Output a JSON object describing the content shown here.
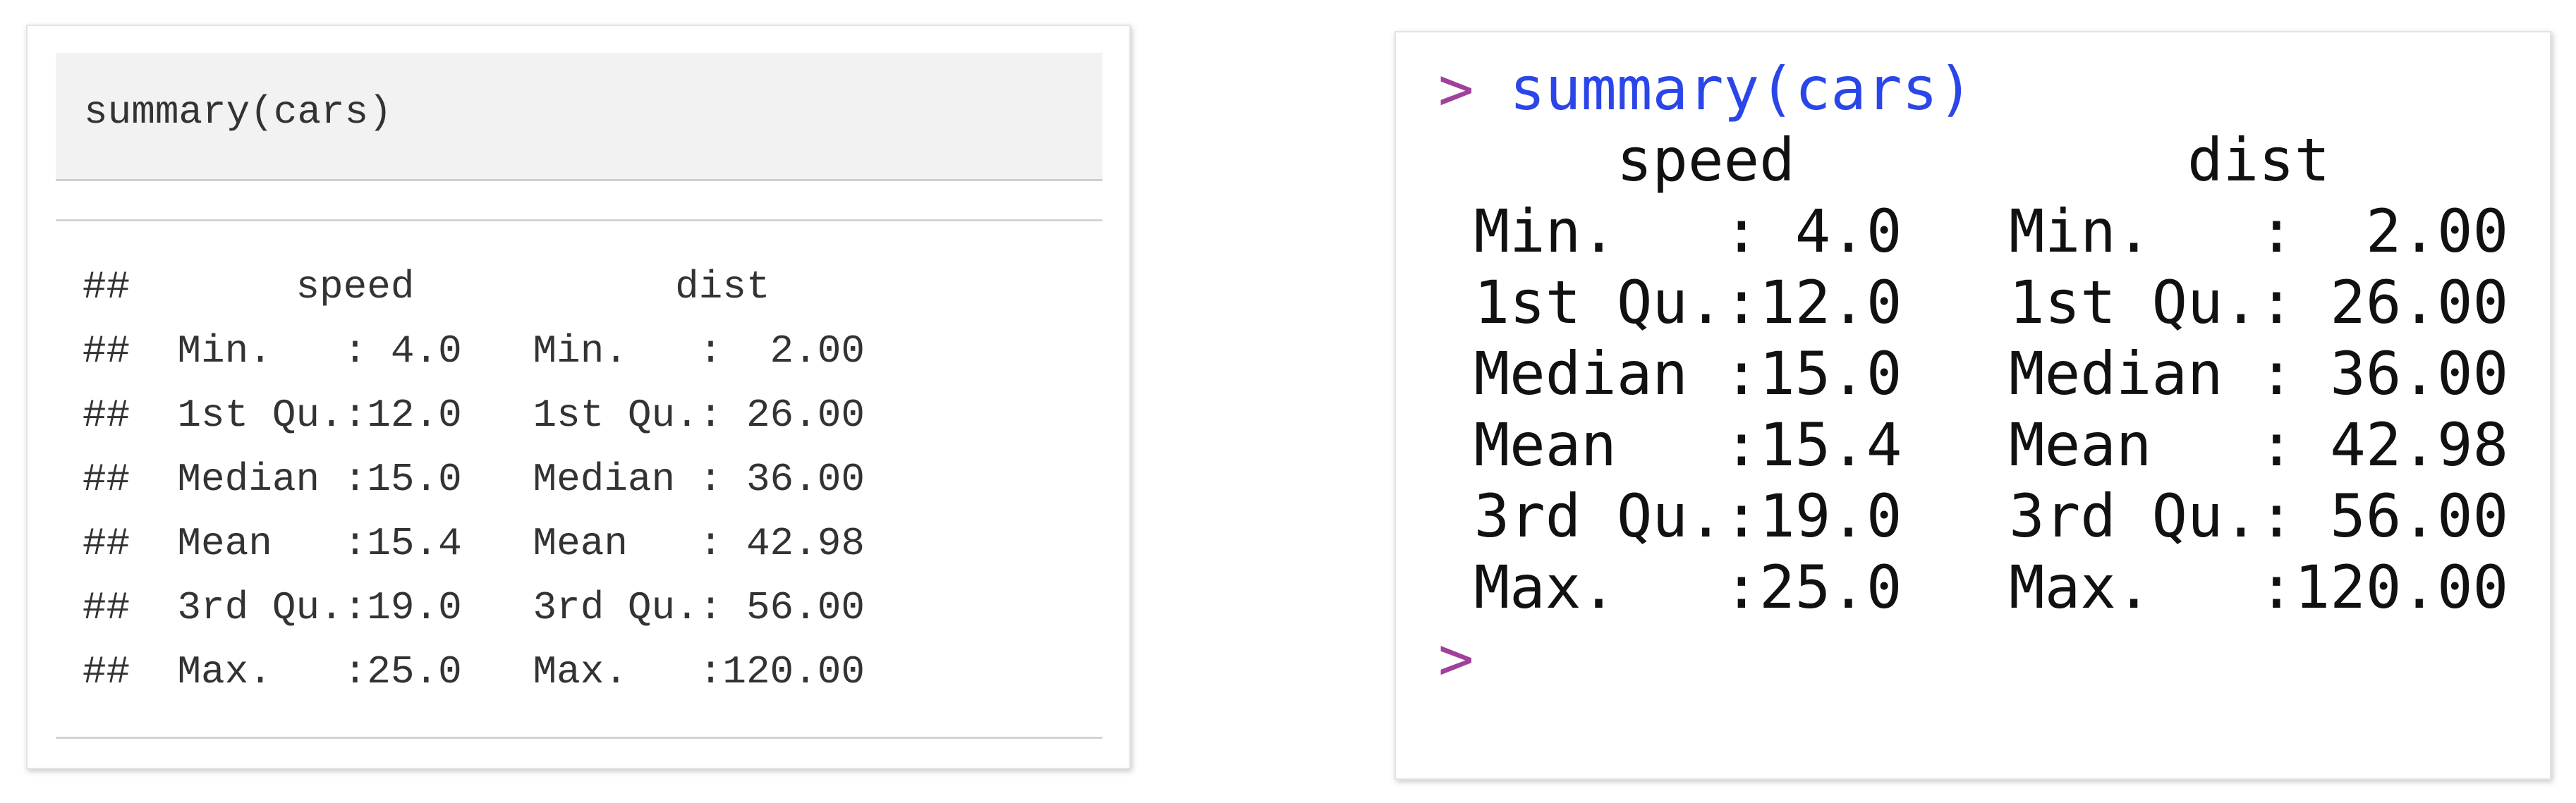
{
  "colors": {
    "prompt": "#a0409c",
    "command": "#2b46e8",
    "output_text": "#111111",
    "rmd_text": "#333333",
    "code_chunk_bg": "#f2f2f2"
  },
  "rmarkdown": {
    "code": "summary(cars)",
    "output_lines": [
      "##       speed           dist       ",
      "##  Min.   : 4.0   Min.   :  2.00  ",
      "##  1st Qu.:12.0   1st Qu.: 26.00  ",
      "##  Median :15.0   Median : 36.00  ",
      "##  Mean   :15.4   Mean   : 42.98  ",
      "##  3rd Qu.:19.0   3rd Qu.: 56.00  ",
      "##  Max.   :25.0   Max.   :120.00  "
    ]
  },
  "console": {
    "prompt": ">",
    "command": "summary(cars)",
    "output_lines": [
      "     speed           dist       ",
      " Min.   : 4.0   Min.   :  2.00  ",
      " 1st Qu.:12.0   1st Qu.: 26.00  ",
      " Median :15.0   Median : 36.00  ",
      " Mean   :15.4   Mean   : 42.98  ",
      " 3rd Qu.:19.0   3rd Qu.: 56.00  ",
      " Max.   :25.0   Max.   :120.00  "
    ],
    "next_prompt": ">"
  }
}
